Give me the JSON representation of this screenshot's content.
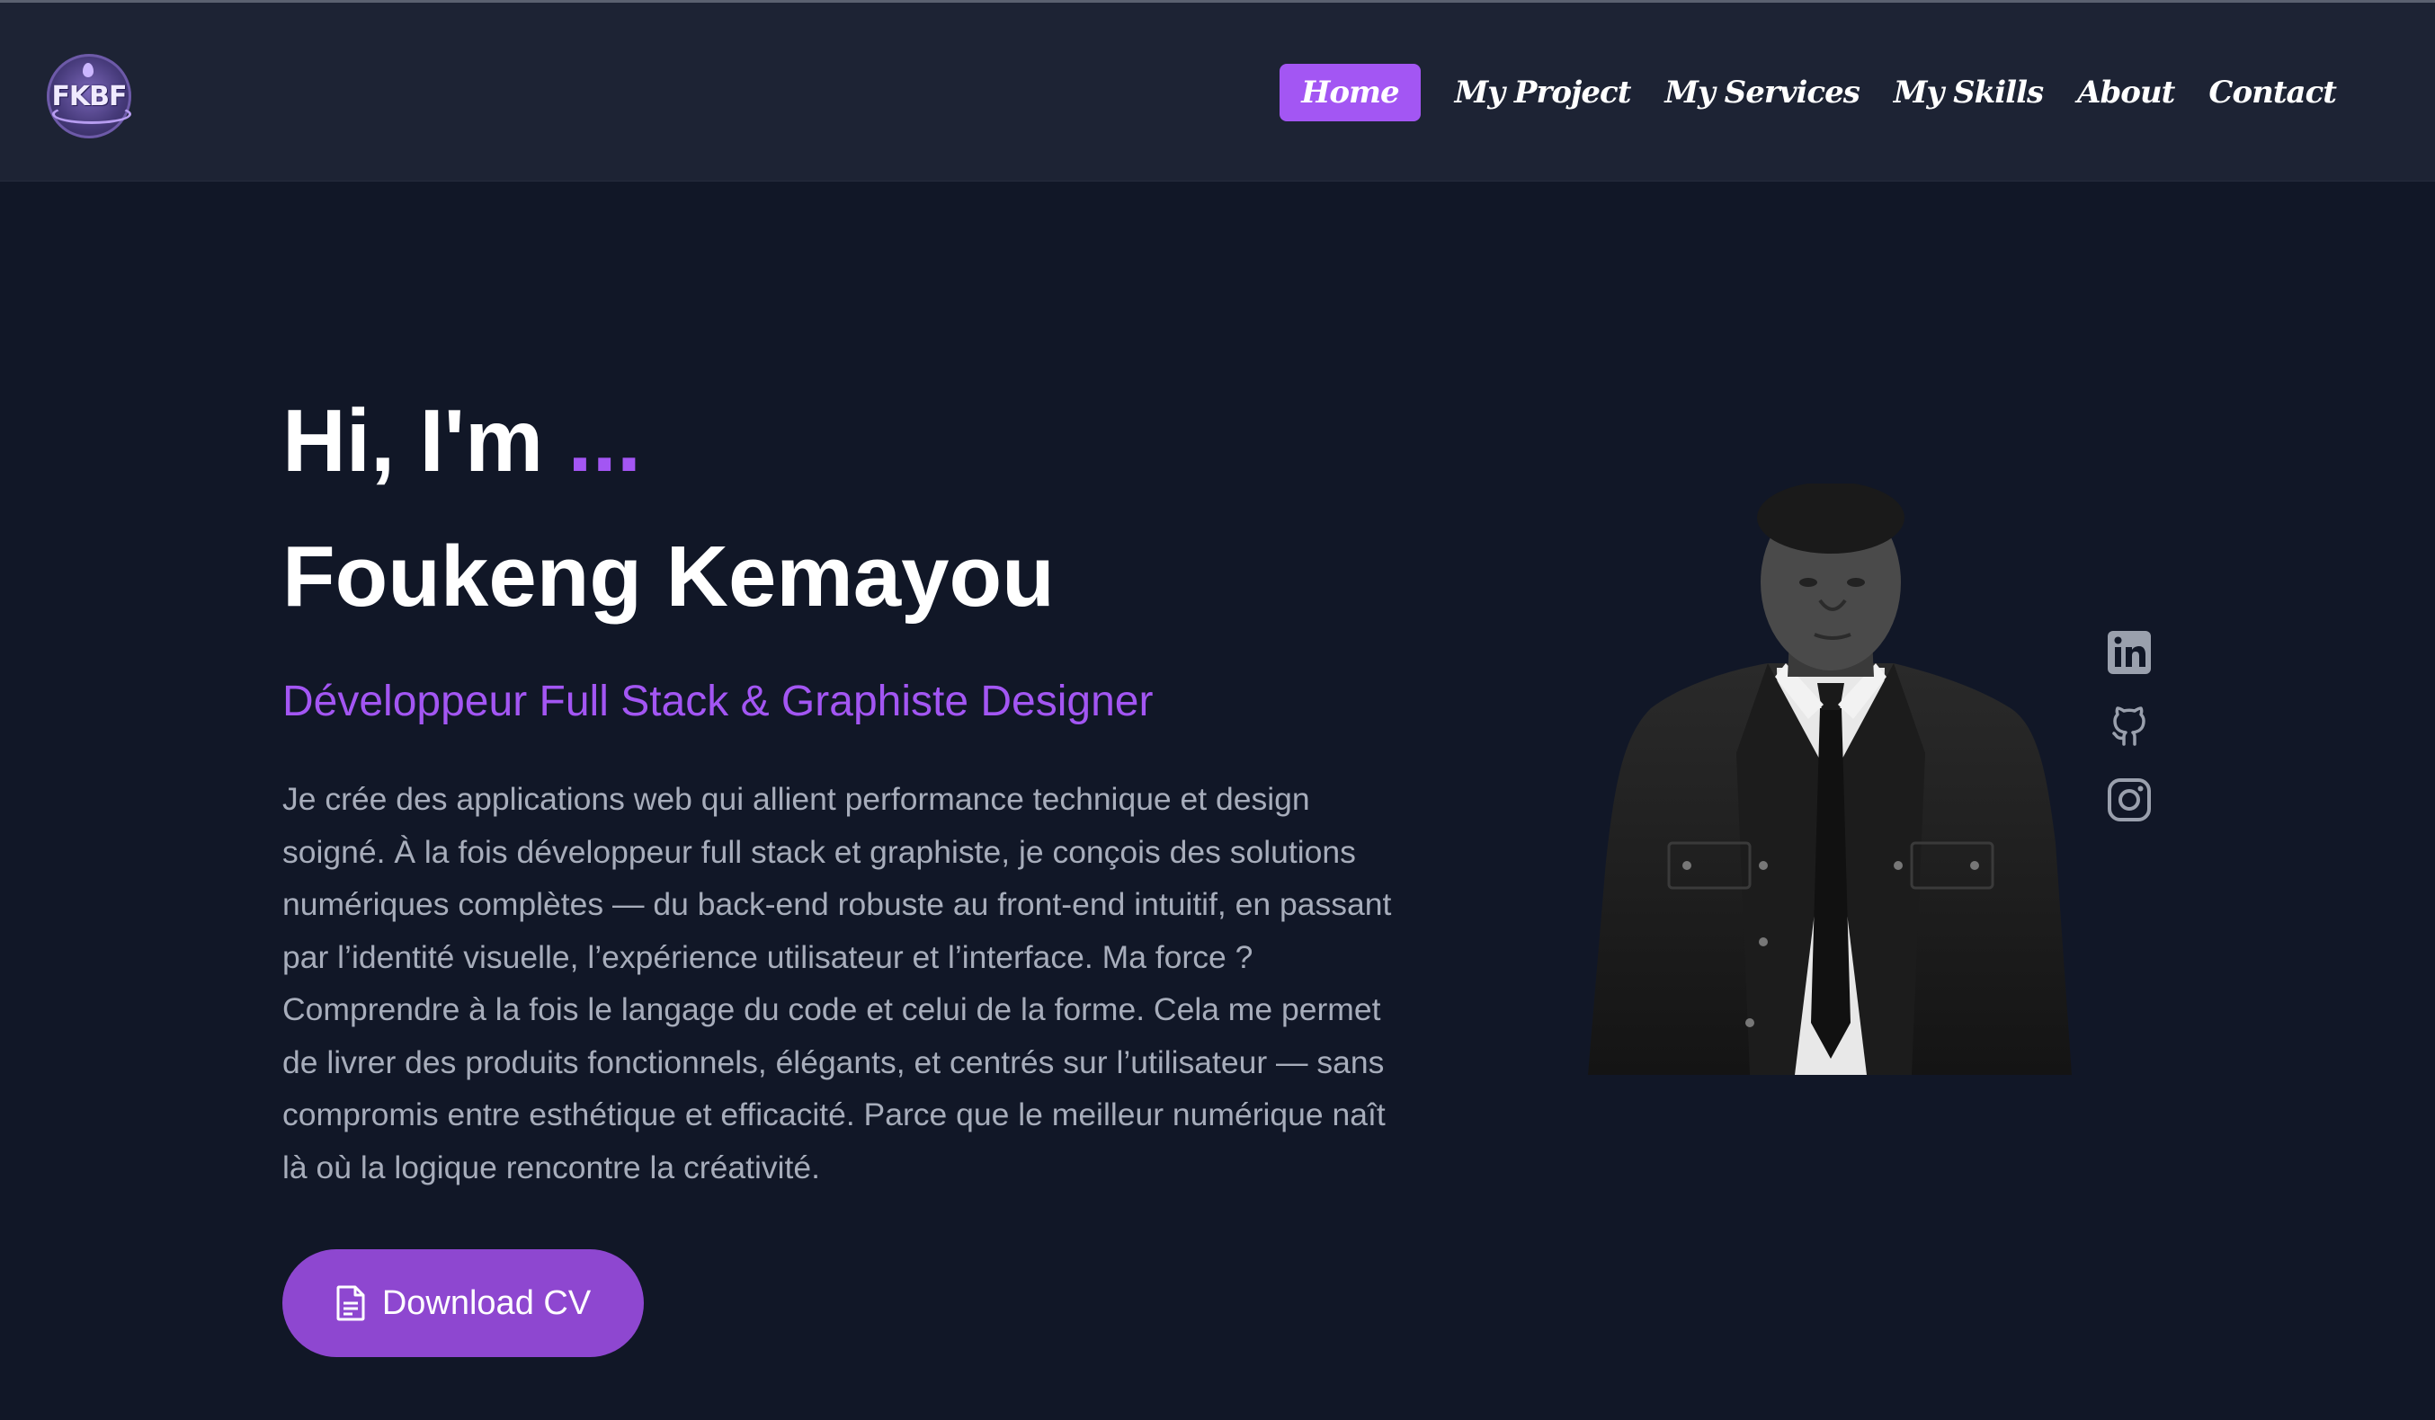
{
  "nav": {
    "logo_text": "FKBF",
    "items": [
      {
        "label": "Home",
        "active": true
      },
      {
        "label": "My Project",
        "active": false
      },
      {
        "label": "My Services",
        "active": false
      },
      {
        "label": "My Skills",
        "active": false
      },
      {
        "label": "About",
        "active": false
      },
      {
        "label": "Contact",
        "active": false
      }
    ]
  },
  "hero": {
    "greeting": "Hi, I'm",
    "greeting_dots": "...",
    "name": "Foukeng Kemayou",
    "role": "Développeur Full Stack & Graphiste Designer",
    "bio_lines": [
      "Je crée des applications web qui allient performance technique et design",
      "soigné. À la fois développeur full stack et graphiste, je conçois des solutions",
      "numériques complètes — du back-end robuste au front-end intuitif, en passant",
      "par l’identité visuelle, l’expérience utilisateur et l’interface. Ma force ?",
      "Comprendre à la fois le langage du code et celui de la forme. Cela me permet",
      "de livrer des produits fonctionnels, élégants, et centrés sur l’utilisateur — sans",
      "compromis entre esthétique et efficacité. Parce que le meilleur numérique naît",
      "là où la logique rencontre la créativité."
    ],
    "cv_button": "Download CV"
  },
  "socials": [
    {
      "icon": "linkedin-icon"
    },
    {
      "icon": "github-icon"
    },
    {
      "icon": "instagram-icon"
    }
  ],
  "colors": {
    "background": "#111727",
    "navbar": "#1d2334",
    "accent": "#a356f3",
    "button": "#8e47d0",
    "text": "#ffffff",
    "muted": "#a7adbb",
    "icon": "#9aa0ad"
  }
}
